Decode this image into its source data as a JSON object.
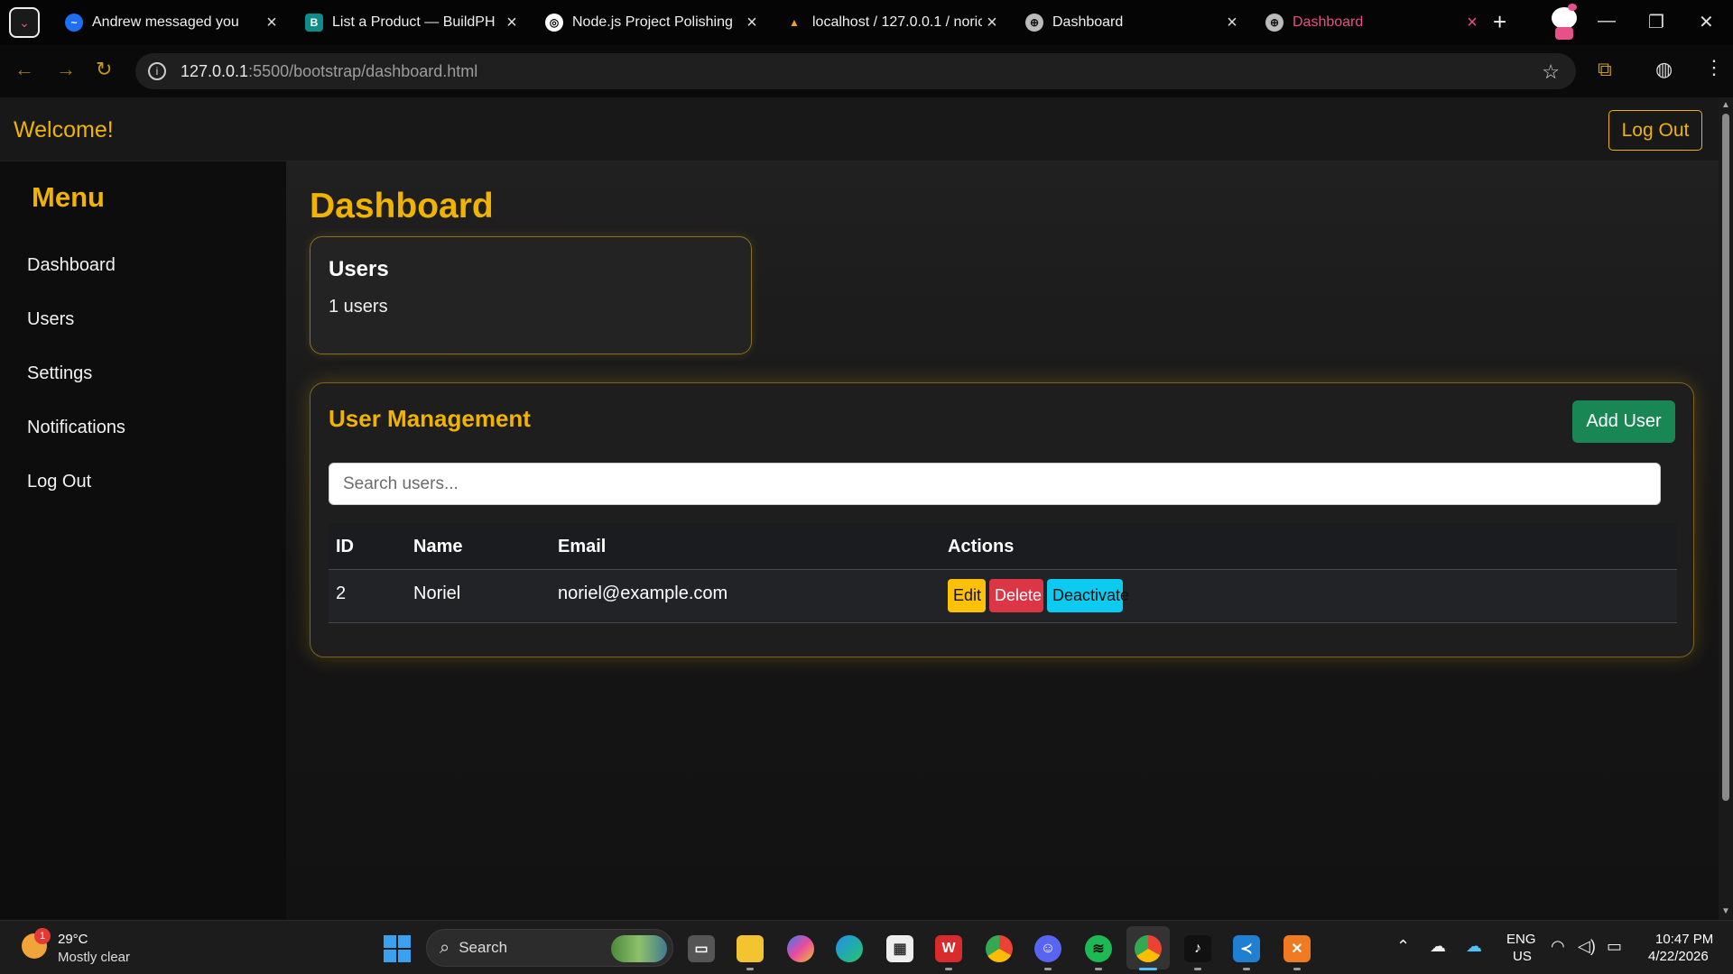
{
  "browser": {
    "tabs": [
      {
        "title": "Andrew messaged you",
        "icon": "messenger-icon",
        "active": false
      },
      {
        "title": "List a Product — BuildPH",
        "icon": "buildph-icon",
        "active": false
      },
      {
        "title": "Node.js Project Polishing",
        "icon": "openai-icon",
        "active": false
      },
      {
        "title": "localhost / 127.0.0.1 / noric",
        "icon": "phpmyadmin-icon",
        "active": false
      },
      {
        "title": "Dashboard",
        "icon": "globe-icon",
        "active": false
      },
      {
        "title": "Dashboard",
        "icon": "globe-icon",
        "active": true
      }
    ],
    "address": {
      "host": "127.0.0.1",
      "path": ":5500/bootstrap/dashboard.html"
    }
  },
  "header": {
    "welcome": "Welcome!",
    "logout_label": "Log Out"
  },
  "sidebar": {
    "title": "Menu",
    "items": [
      {
        "label": "Dashboard"
      },
      {
        "label": "Users"
      },
      {
        "label": "Settings"
      },
      {
        "label": "Notifications"
      },
      {
        "label": "Log Out"
      }
    ]
  },
  "main": {
    "title": "Dashboard",
    "users_card": {
      "title": "Users",
      "count": "1 users"
    },
    "user_management": {
      "title": "User Management",
      "add_label": "Add User",
      "search_placeholder": "Search users...",
      "columns": [
        "ID",
        "Name",
        "Email",
        "Actions"
      ],
      "rows": [
        {
          "id": "2",
          "name": "Noriel",
          "email": "noriel@example.com"
        }
      ],
      "actions": {
        "edit": "Edit",
        "delete": "Delete",
        "deactivate": "Deactivate"
      }
    }
  },
  "colors": {
    "accent": "#f0b400",
    "success": "#198754",
    "danger": "#dc3545",
    "info": "#0dcaf0",
    "warning": "#ffc107"
  },
  "taskbar": {
    "weather": {
      "temp": "29°C",
      "desc": "Mostly clear",
      "badge": "1"
    },
    "search_label": "Search",
    "lang": "ENG",
    "region": "US",
    "time": "10:47 PM",
    "date": "4/22/2026"
  }
}
